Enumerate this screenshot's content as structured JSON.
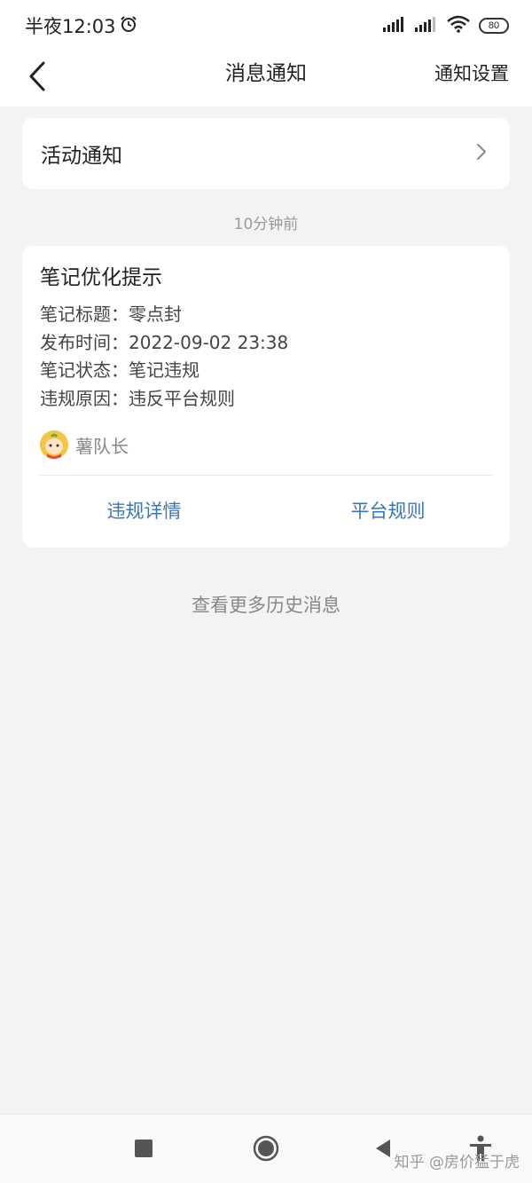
{
  "status_bar": {
    "time": "半夜12:03",
    "battery": "80"
  },
  "header": {
    "title": "消息通知",
    "action_label": "通知设置"
  },
  "activity": {
    "label": "活动通知"
  },
  "timestamp": "10分钟前",
  "message": {
    "title": "笔记优化提示",
    "lines": [
      {
        "key": "笔记标题：",
        "value": "零点封"
      },
      {
        "key": "发布时间：",
        "value": "2022-09-02 23:38"
      },
      {
        "key": "笔记状态：",
        "value": "笔记违规"
      },
      {
        "key": "违规原因：",
        "value": "违反平台规则"
      }
    ],
    "sender": "薯队长",
    "actions": {
      "details_label": "违规详情",
      "rules_label": "平台规则"
    }
  },
  "more_history": "查看更多历史消息",
  "watermark": "知乎 @房价猛于虎",
  "icons": {
    "back": "chevron-left-icon",
    "arrow": "chevron-right-icon",
    "alarm": "alarm-icon",
    "signal": "signal-icon",
    "wifi": "wifi-icon",
    "battery": "battery-icon",
    "recent_apps": "square-icon",
    "home": "circle-icon",
    "back_nav": "triangle-back-icon",
    "accessibility": "accessibility-icon"
  },
  "colors": {
    "background": "#f3f3f3",
    "card": "#ffffff",
    "link": "#3d76b8",
    "muted": "#999999"
  }
}
